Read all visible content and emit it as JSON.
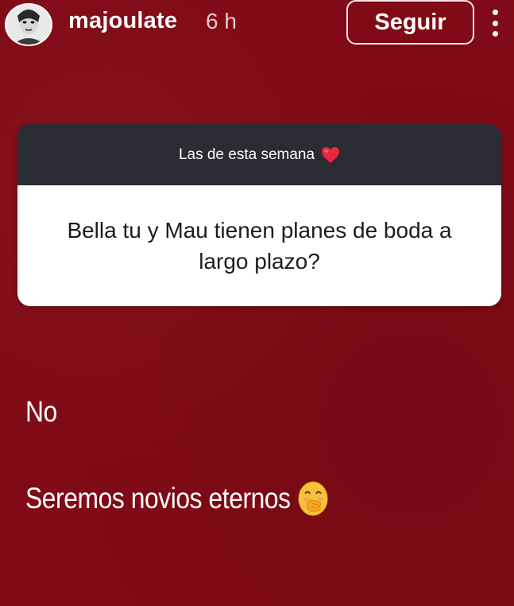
{
  "header": {
    "username": "majoulate",
    "timestamp": "6 h",
    "follow_label": "Seguir",
    "avatar_icon": "profile-avatar",
    "more_icon": "more-vertical-icon"
  },
  "sticker": {
    "heading": "Las de esta semana",
    "heading_icon": "red-heart-icon",
    "question": "Bella tu y Mau tienen planes de boda a largo plazo?"
  },
  "answers": [
    {
      "text": "No"
    },
    {
      "text": "Seremos novios eternos",
      "emoji": "hand-over-mouth-emoji"
    }
  ],
  "colors": {
    "background": "#800a15",
    "sticker_header": "#2b2b33",
    "sticker_body": "#ffffff",
    "text_light": "#ffffff",
    "heart": "#e8283c",
    "emoji_yellow": "#f7c23b"
  }
}
